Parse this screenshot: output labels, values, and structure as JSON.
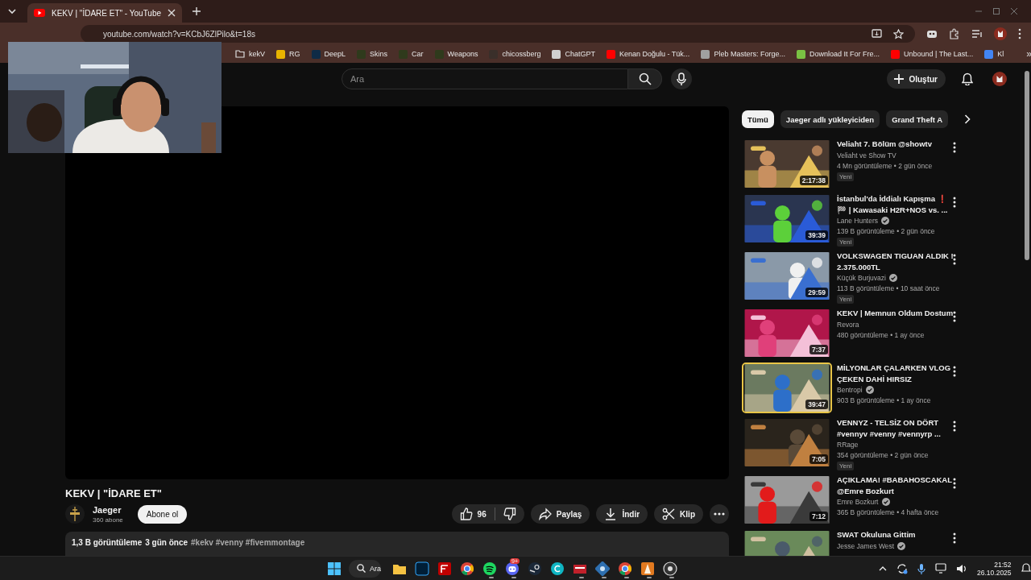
{
  "browser": {
    "tab": {
      "title": "KEKV | \"İDARE ET\" - YouTube",
      "selected": true
    },
    "url": "youtube.com/watch?v=KCbJ6ZlPilo&t=18s",
    "bookmarks": [
      {
        "label": "kekV",
        "kind": "folder"
      },
      {
        "label": "RG",
        "kind": "site",
        "color": "#e8b400"
      },
      {
        "label": "DeepL",
        "kind": "site",
        "color": "#0f2b46"
      },
      {
        "label": "Skins",
        "kind": "site",
        "color": "#2f3a1c"
      },
      {
        "label": "Car",
        "kind": "site",
        "color": "#2f3a1c"
      },
      {
        "label": "Weapons",
        "kind": "site",
        "color": "#2f3a1c"
      },
      {
        "label": "chicossberg",
        "kind": "site",
        "color": "#3a2f2a"
      },
      {
        "label": "ChatGPT",
        "kind": "site",
        "color": "#d0d0d0"
      },
      {
        "label": "Kenan Doğulu - Tük...",
        "kind": "site",
        "color": "#ff0000"
      },
      {
        "label": "Pleb Masters: Forge...",
        "kind": "site",
        "color": "#a0a0a0"
      },
      {
        "label": "Download It For Fre...",
        "kind": "site",
        "color": "#7ac143"
      },
      {
        "label": "Unbound | The Last...",
        "kind": "site",
        "color": "#ff0000"
      },
      {
        "label": "Kl",
        "kind": "site",
        "color": "#4285f4"
      }
    ],
    "bookmarks_more": "»"
  },
  "youtube": {
    "search": {
      "placeholder": "Ara"
    },
    "create": "Oluştur",
    "video": {
      "title": "KEKV | \"İDARE ET\"",
      "channel": "Jaeger",
      "subscribers": "360 abone",
      "subscribe": "Abone ol",
      "likes": "96",
      "actions": [
        "Paylaş",
        "İndir",
        "Klip"
      ],
      "views": "1,3 B görüntüleme",
      "date": "3 gün önce",
      "tags": "#kekv #venny #fivemmontage"
    },
    "chips": [
      {
        "label": "Tümü",
        "selected": true
      },
      {
        "label": "Jaeger adlı yükleyiciden",
        "selected": false
      },
      {
        "label": "Grand Theft A",
        "selected": false
      }
    ],
    "recommendations": [
      {
        "title_lines": [
          "Veliaht 7. Bölüm @showtv"
        ],
        "channel": "Veliaht ve Show TV",
        "verified": false,
        "meta": "4 Mn görüntüleme • 2 gün önce",
        "badge": "Yeni",
        "duration": "2:17:38",
        "selected": false
      },
      {
        "title_lines": [
          "İstanbul'da İddialı Kapışma ❗",
          "🏁 | Kawasaki H2R+NOS vs. ..."
        ],
        "channel": "Lane Hunters",
        "verified": true,
        "meta": "139 B görüntüleme • 2 gün önce",
        "badge": "Yeni",
        "duration": "39:39",
        "selected": false
      },
      {
        "title_lines": [
          "VOLKSWAGEN TIGUAN ALDIK !",
          "2.375.000TL"
        ],
        "channel": "Küçük Burjuvazi",
        "verified": true,
        "meta": "113 B görüntüleme • 10 saat önce",
        "badge": "Yeni",
        "duration": "29:59",
        "selected": false
      },
      {
        "title_lines": [
          "KEKV | Memnun Oldum Dostum"
        ],
        "channel": "Revora",
        "verified": false,
        "meta": "480 görüntüleme • 1 ay önce",
        "duration": "7:37",
        "selected": false
      },
      {
        "title_lines": [
          "MİLYONLAR ÇALARKEN VLOG",
          "ÇEKEN DAHİ HIRSIZ"
        ],
        "channel": "Bentropi",
        "verified": true,
        "meta": "903 B görüntüleme • 1 ay önce",
        "duration": "39:47",
        "selected": true
      },
      {
        "title_lines": [
          "VENNYZ - TELSİZ ON DÖRT",
          "#vennyv #venny #vennyrp ..."
        ],
        "channel": "RRage",
        "verified": false,
        "meta": "354 görüntüleme • 2 gün önce",
        "badge": "Yeni",
        "duration": "7:05",
        "selected": false
      },
      {
        "title_lines": [
          "AÇIKLAMA! #BABAHOSCAKAL",
          "@Emre Bozkurt"
        ],
        "channel": "Emre Bozkurt",
        "verified": true,
        "meta": "365 B görüntüleme • 4 hafta önce",
        "duration": "7:12",
        "selected": false
      },
      {
        "title_lines": [
          "SWAT Okuluna Gittim"
        ],
        "channel": "Jesse James West",
        "verified": true,
        "selected": false
      }
    ]
  },
  "taskbar": {
    "search": "Ara",
    "time": "21:52",
    "date": "26.10.2025",
    "apps": [
      {
        "kind": "folder",
        "running": false
      },
      {
        "kind": "photoshop",
        "running": false
      },
      {
        "kind": "filezilla",
        "running": false
      },
      {
        "kind": "chrome",
        "running": false
      },
      {
        "kind": "spotify",
        "running": true
      },
      {
        "kind": "discord",
        "running": true,
        "badge": "9+"
      },
      {
        "kind": "steam",
        "running": false
      },
      {
        "kind": "canva",
        "running": false
      },
      {
        "kind": "mixer",
        "running": true
      },
      {
        "kind": "tool",
        "running": true
      },
      {
        "kind": "chrome",
        "running": true
      },
      {
        "kind": "cone",
        "running": true
      },
      {
        "kind": "recorder",
        "running": true
      }
    ]
  }
}
